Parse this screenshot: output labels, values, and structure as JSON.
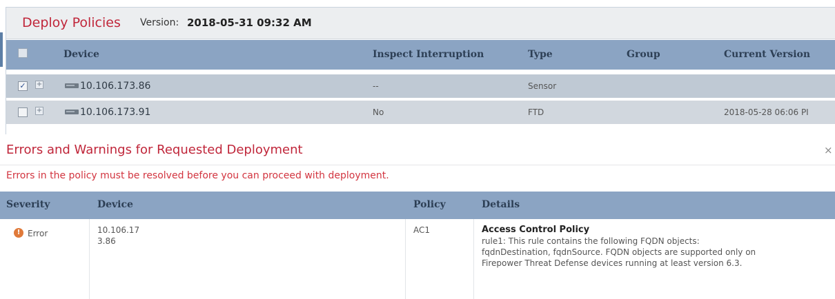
{
  "deploy": {
    "title": "Deploy Policies",
    "version_label": "Version:",
    "version_value": "2018-05-31 09:32 AM",
    "columns": [
      "Device",
      "Inspect Interruption",
      "Type",
      "Group",
      "Current Version"
    ],
    "rows": [
      {
        "checked": true,
        "check_glyph": "✓",
        "expand_glyph": "+",
        "device": "10.106.173.86",
        "inspect": "--",
        "type": "Sensor",
        "group": "",
        "current_version": ""
      },
      {
        "checked": false,
        "check_glyph": "",
        "expand_glyph": "+",
        "device": "10.106.173.91",
        "inspect": "No",
        "type": "FTD",
        "group": "",
        "current_version": "2018-05-28 06:06 PI"
      }
    ]
  },
  "errors": {
    "title": "Errors and Warnings for Requested Deployment",
    "close_glyph": "×",
    "message": "Errors in the policy must be resolved before you can proceed with deployment.",
    "columns": [
      "Severity",
      "Device",
      "Policy",
      "Details"
    ],
    "rows": [
      {
        "severity_icon": "!",
        "severity": "Error",
        "device_line1": "10.106.17",
        "device_line2": "3.86",
        "policy": "AC1",
        "details_title": "Access Control Policy",
        "details_line1": "rule1: This rule contains the following FQDN objects:",
        "details_line2": "fqdnDestination, fqdnSource. FQDN objects are supported only on",
        "details_line3": "Firepower Threat Defense devices running at least version 6.3."
      }
    ]
  },
  "colors": {
    "title_red": "#c0263a",
    "header_blue": "#8ba4c3",
    "error_orange": "#e07a3a"
  }
}
